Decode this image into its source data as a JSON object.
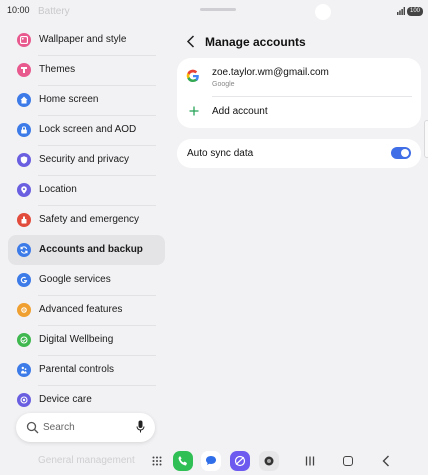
{
  "status": {
    "time": "10:00",
    "battery": "100"
  },
  "settings_list": {
    "faded_top": "Battery",
    "items": [
      {
        "label": "Wallpaper and style",
        "icon": "wallpaper-icon",
        "color": "#e85a8e"
      },
      {
        "label": "Themes",
        "icon": "themes-icon",
        "color": "#e85a8e"
      },
      {
        "label": "Home screen",
        "icon": "home-icon",
        "color": "#3d7be8"
      },
      {
        "label": "Lock screen and AOD",
        "icon": "lock-icon",
        "color": "#3d7be8"
      },
      {
        "label": "Security and privacy",
        "icon": "shield-icon",
        "color": "#6a5fe0"
      },
      {
        "label": "Location",
        "icon": "location-pin-icon",
        "color": "#6a5fe0"
      },
      {
        "label": "Safety and emergency",
        "icon": "emergency-icon",
        "color": "#e24c3c"
      },
      {
        "label": "Accounts and backup",
        "icon": "sync-icon",
        "color": "#3d7be8"
      },
      {
        "label": "Google services",
        "icon": "google-icon",
        "color": "#3d7be8"
      },
      {
        "label": "Advanced features",
        "icon": "advanced-features-icon",
        "color": "#f0a030"
      },
      {
        "label": "Digital Wellbeing",
        "icon": "wellbeing-icon",
        "color": "#3fb84f"
      },
      {
        "label": "Parental controls",
        "icon": "parental-icon",
        "color": "#3d7be8"
      },
      {
        "label": "Device care",
        "icon": "device-care-icon",
        "color": "#6a5fe0"
      }
    ],
    "faded_bottom": "General management",
    "search_placeholder": "Search"
  },
  "manage_accounts": {
    "title": "Manage accounts",
    "account_email": "zoe.taylor.wm@gmail.com",
    "account_provider": "Google",
    "add_account_label": "Add account",
    "auto_sync_label": "Auto sync data",
    "auto_sync_on": true
  },
  "colors": {
    "accent": "#3f6ee6",
    "active_row": "#e4e4e7",
    "plus_green": "#2aa35a"
  }
}
